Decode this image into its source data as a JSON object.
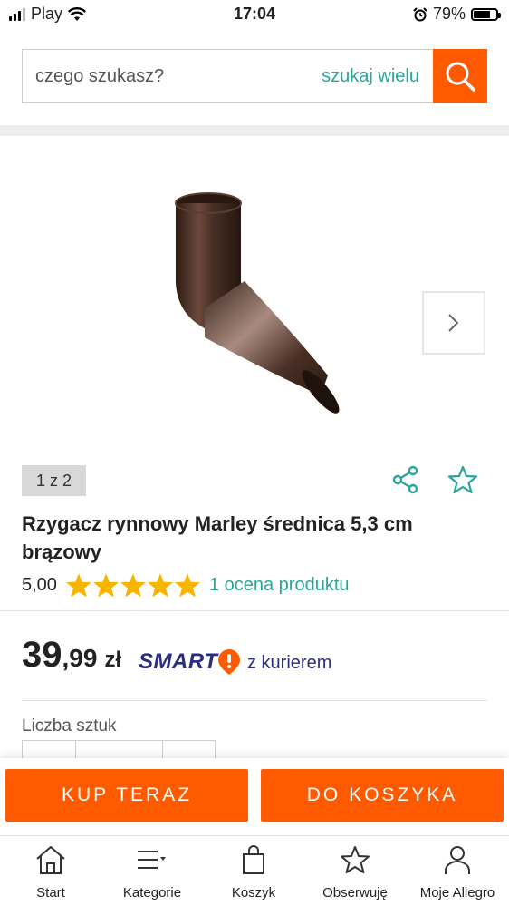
{
  "status_bar": {
    "carrier": "Play",
    "time": "17:04",
    "battery": "79%"
  },
  "search": {
    "placeholder": "czego szukasz?",
    "multi_search_label": "szukaj wielu",
    "button_icon": "search-icon"
  },
  "gallery": {
    "counter": "1 z 2",
    "next_icon": "chevron-right-icon",
    "share_icon": "share-icon",
    "favorite_icon": "star-outline-icon"
  },
  "product": {
    "title": "Rzygacz rynnowy Marley średnica 5,3 cm brązowy",
    "rating_value": "5,00",
    "stars_filled": 5,
    "stars_total": 5,
    "reviews_label": "1 ocena produktu"
  },
  "price": {
    "integer": "39",
    "decimal": ",99",
    "currency": "zł",
    "smart_badge": "SMART",
    "delivery": "z kurierem"
  },
  "quantity": {
    "label": "Liczba sztuk"
  },
  "actions": {
    "buy_now": "KUP TERAZ",
    "add_to_cart": "DO KOSZYKA"
  },
  "tabbar": {
    "items": [
      {
        "label": "Start",
        "icon": "home-icon"
      },
      {
        "label": "Kategorie",
        "icon": "menu-icon"
      },
      {
        "label": "Koszyk",
        "icon": "bag-icon"
      },
      {
        "label": "Obserwuję",
        "icon": "star-outline-icon"
      },
      {
        "label": "Moje Allegro",
        "icon": "user-icon"
      }
    ]
  },
  "colors": {
    "accent": "#ff5a00",
    "teal": "#2aa59b",
    "star": "#f7b500",
    "smart_navy": "#2b2d82"
  }
}
